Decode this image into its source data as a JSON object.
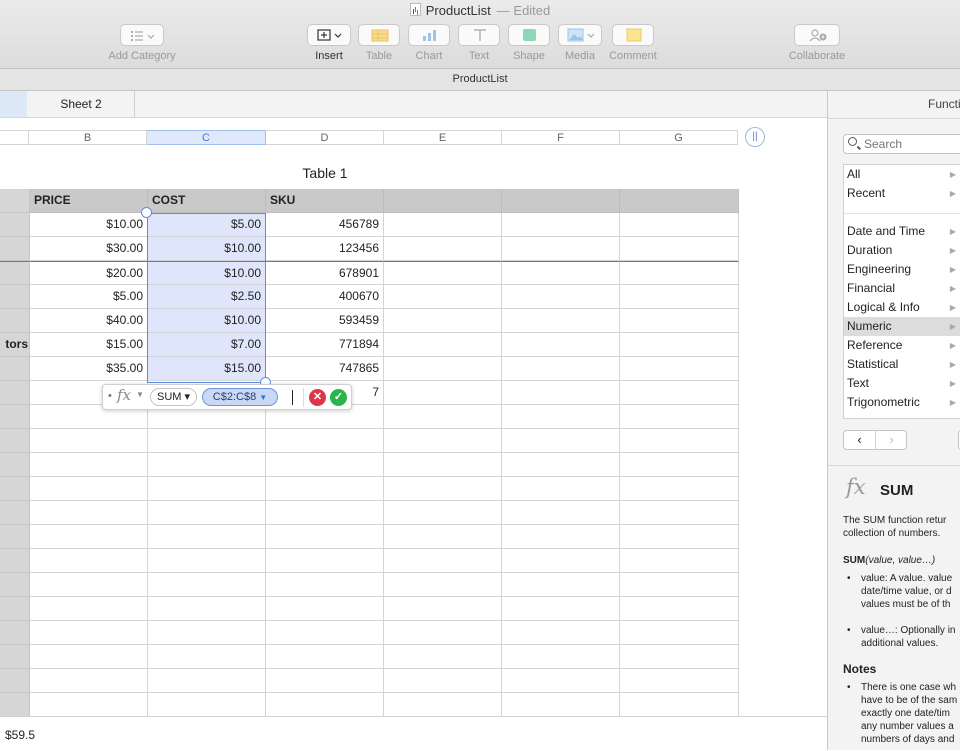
{
  "window": {
    "title": "ProductList",
    "status": "— Edited"
  },
  "toolbar": {
    "items": [
      {
        "label": "Add Category",
        "icon": "list-icon",
        "enabled": false
      },
      {
        "label": "Insert",
        "icon": "insert-icon",
        "enabled": true
      },
      {
        "label": "Table",
        "icon": "table-icon",
        "enabled": false
      },
      {
        "label": "Chart",
        "icon": "chart-icon",
        "enabled": false
      },
      {
        "label": "Text",
        "icon": "text-icon",
        "enabled": false
      },
      {
        "label": "Shape",
        "icon": "shape-icon",
        "enabled": false
      },
      {
        "label": "Media",
        "icon": "media-icon",
        "enabled": false
      },
      {
        "label": "Comment",
        "icon": "comment-icon",
        "enabled": false
      },
      {
        "label": "Collaborate",
        "icon": "collaborate-icon",
        "enabled": false
      }
    ]
  },
  "document_name": "ProductList",
  "sheet_tabs": [
    "Sheet 2"
  ],
  "columns": [
    "B",
    "C",
    "D",
    "E",
    "F",
    "G"
  ],
  "table": {
    "title": "Table 1",
    "headers": [
      "PRICE",
      "COST",
      "SKU"
    ],
    "row_label_fragment": "tors",
    "rows": [
      {
        "price": "$10.00",
        "cost": "$5.00",
        "sku": "456789"
      },
      {
        "price": "$30.00",
        "cost": "$10.00",
        "sku": "123456"
      },
      {
        "price": "$20.00",
        "cost": "$10.00",
        "sku": "678901"
      },
      {
        "price": "$5.00",
        "cost": "$2.50",
        "sku": "400670"
      },
      {
        "price": "$40.00",
        "cost": "$10.00",
        "sku": "593459"
      },
      {
        "price": "$15.00",
        "cost": "$7.00",
        "sku": "771894"
      },
      {
        "price": "$35.00",
        "cost": "$15.00",
        "sku": "747865"
      }
    ],
    "formula_row_sku": "7"
  },
  "formula_editor": {
    "function": "SUM",
    "range": "C$2:C$8",
    "cancel_symbol": "✕",
    "accept_symbol": "✓"
  },
  "status_bar": {
    "sum": "$59.5"
  },
  "functions_panel": {
    "title": "Functions",
    "search_placeholder": "Search",
    "categories_top": [
      "All",
      "Recent"
    ],
    "categories": [
      "Date and Time",
      "Duration",
      "Engineering",
      "Financial",
      "Logical & Info",
      "Numeric",
      "Reference",
      "Statistical",
      "Text",
      "Trigonometric"
    ],
    "selected_category": "Numeric",
    "function_name": "SUM",
    "description_lines": [
      "The SUM function retur",
      "collection of numbers."
    ],
    "syntax_name": "SUM",
    "syntax_args": "(value, value…)",
    "arg1_lines": [
      "value: A value. value",
      "date/time value, or d",
      "values must be of th"
    ],
    "arg2_lines": [
      "value…: Optionally in",
      "additional values."
    ],
    "notes_heading": "Notes",
    "notes_lines": [
      "There is one case wh",
      "have to be of the sam",
      "exactly one date/tim",
      "any number values a",
      "numbers of days and"
    ]
  }
}
